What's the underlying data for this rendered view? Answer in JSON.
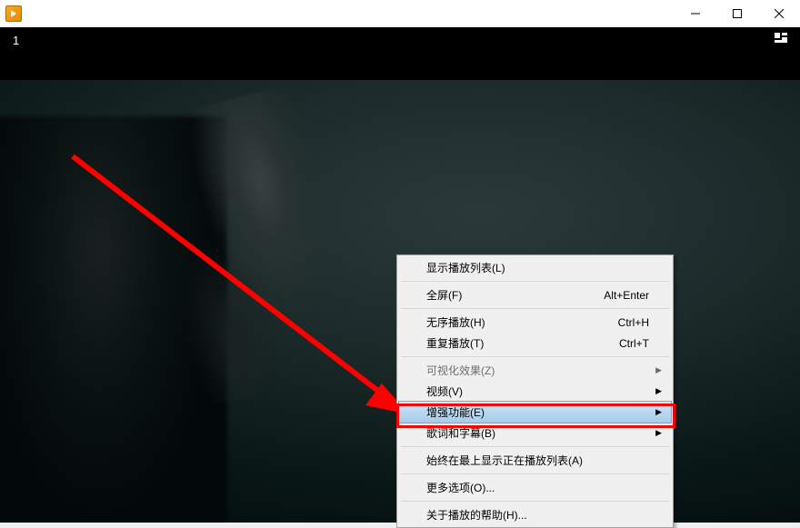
{
  "titlebar": {
    "label_number": "1"
  },
  "menu": {
    "items": [
      {
        "label": "显示播放列表(L)",
        "shortcut": "",
        "submenu": false,
        "disabled": false
      },
      {
        "sep": true
      },
      {
        "label": "全屏(F)",
        "shortcut": "Alt+Enter",
        "submenu": false,
        "disabled": false
      },
      {
        "sep": true
      },
      {
        "label": "无序播放(H)",
        "shortcut": "Ctrl+H",
        "submenu": false,
        "disabled": false
      },
      {
        "label": "重复播放(T)",
        "shortcut": "Ctrl+T",
        "submenu": false,
        "disabled": false
      },
      {
        "sep": true
      },
      {
        "label": "可视化效果(Z)",
        "shortcut": "",
        "submenu": true,
        "disabled": true
      },
      {
        "label": "视频(V)",
        "shortcut": "",
        "submenu": true,
        "disabled": false
      },
      {
        "label": "增强功能(E)",
        "shortcut": "",
        "submenu": true,
        "disabled": false,
        "highlighted": true
      },
      {
        "label": "歌词和字幕(B)",
        "shortcut": "",
        "submenu": true,
        "disabled": false
      },
      {
        "sep": true
      },
      {
        "label": "始终在最上显示正在播放列表(A)",
        "shortcut": "",
        "submenu": false,
        "disabled": false
      },
      {
        "sep": true
      },
      {
        "label": "更多选项(O)...",
        "shortcut": "",
        "submenu": false,
        "disabled": false
      },
      {
        "sep": true
      },
      {
        "label": "关于播放的帮助(H)...",
        "shortcut": "",
        "submenu": false,
        "disabled": false
      }
    ]
  }
}
